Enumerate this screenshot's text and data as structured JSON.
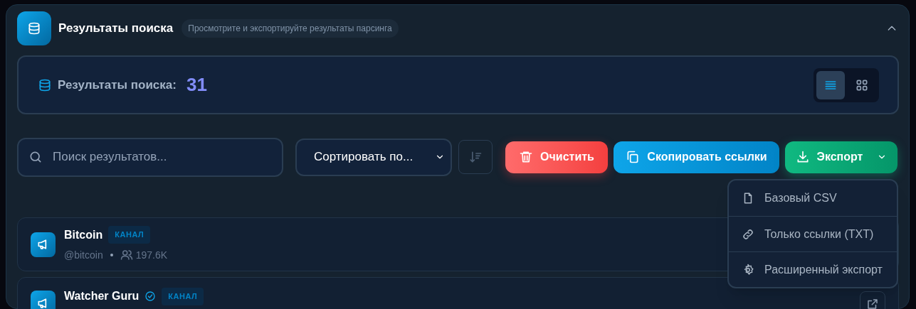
{
  "header": {
    "title": "Результаты поиска",
    "subtitle": "Просмотрите и экспортируйте результаты парсинга",
    "expanded": true
  },
  "stats": {
    "label": "Результаты поиска:",
    "count": "31",
    "views": [
      {
        "kind": "list",
        "selected": true
      },
      {
        "kind": "grid",
        "selected": false
      }
    ]
  },
  "toolbar": {
    "search_placeholder": "Поиск результатов...",
    "sort_value": "Сортировать по...",
    "buttons": [
      {
        "kind": "clear",
        "label": "Очистить"
      },
      {
        "kind": "copy",
        "label": "Скопировать ссылки"
      },
      {
        "kind": "export",
        "label": "Экспорт"
      }
    ]
  },
  "export_menu": {
    "open": true,
    "items": [
      {
        "kind": "file",
        "label": "Базовый CSV"
      },
      {
        "kind": "link",
        "label": "Только ссылки (TXT)"
      },
      {
        "kind": "settings",
        "label": "Расширенный экспорт"
      }
    ]
  },
  "results": [
    {
      "name": "Bitcoin",
      "verified": false,
      "badge": "КАНАЛ",
      "handle": "@bitcoin",
      "members": "197.6K"
    },
    {
      "name": "Watcher Guru",
      "verified": true,
      "badge": "КАНАЛ"
    }
  ]
}
